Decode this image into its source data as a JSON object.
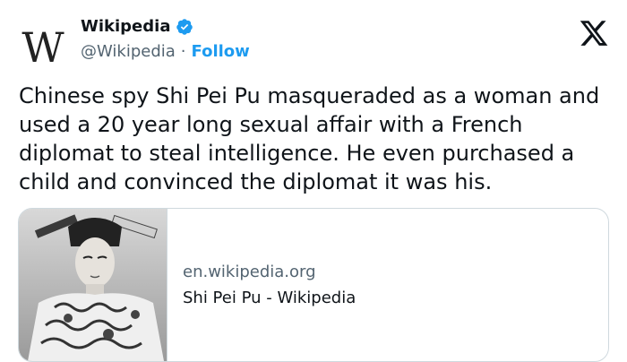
{
  "author": {
    "display_name": "Wikipedia",
    "handle": "@Wikipedia",
    "separator": "·",
    "follow_label": "Follow",
    "avatar_icon": "wikipedia-logo-icon",
    "verified_icon": "verified-badge-icon"
  },
  "tweet": {
    "text": "Chinese spy Shi Pei Pu masqueraded as a woman and used a 20 year long sexual affair with a French diplomat to steal intelligence. He even purchased a child and convinced the diplomat it was his."
  },
  "link_card": {
    "domain": "en.wikipedia.org",
    "title": "Shi Pei Pu - Wikipedia"
  },
  "colors": {
    "accent": "#1d9bf0",
    "text": "#0f1419",
    "secondary_text": "#536471",
    "border": "#cfd9de"
  },
  "platform_icon": "x-logo-icon"
}
